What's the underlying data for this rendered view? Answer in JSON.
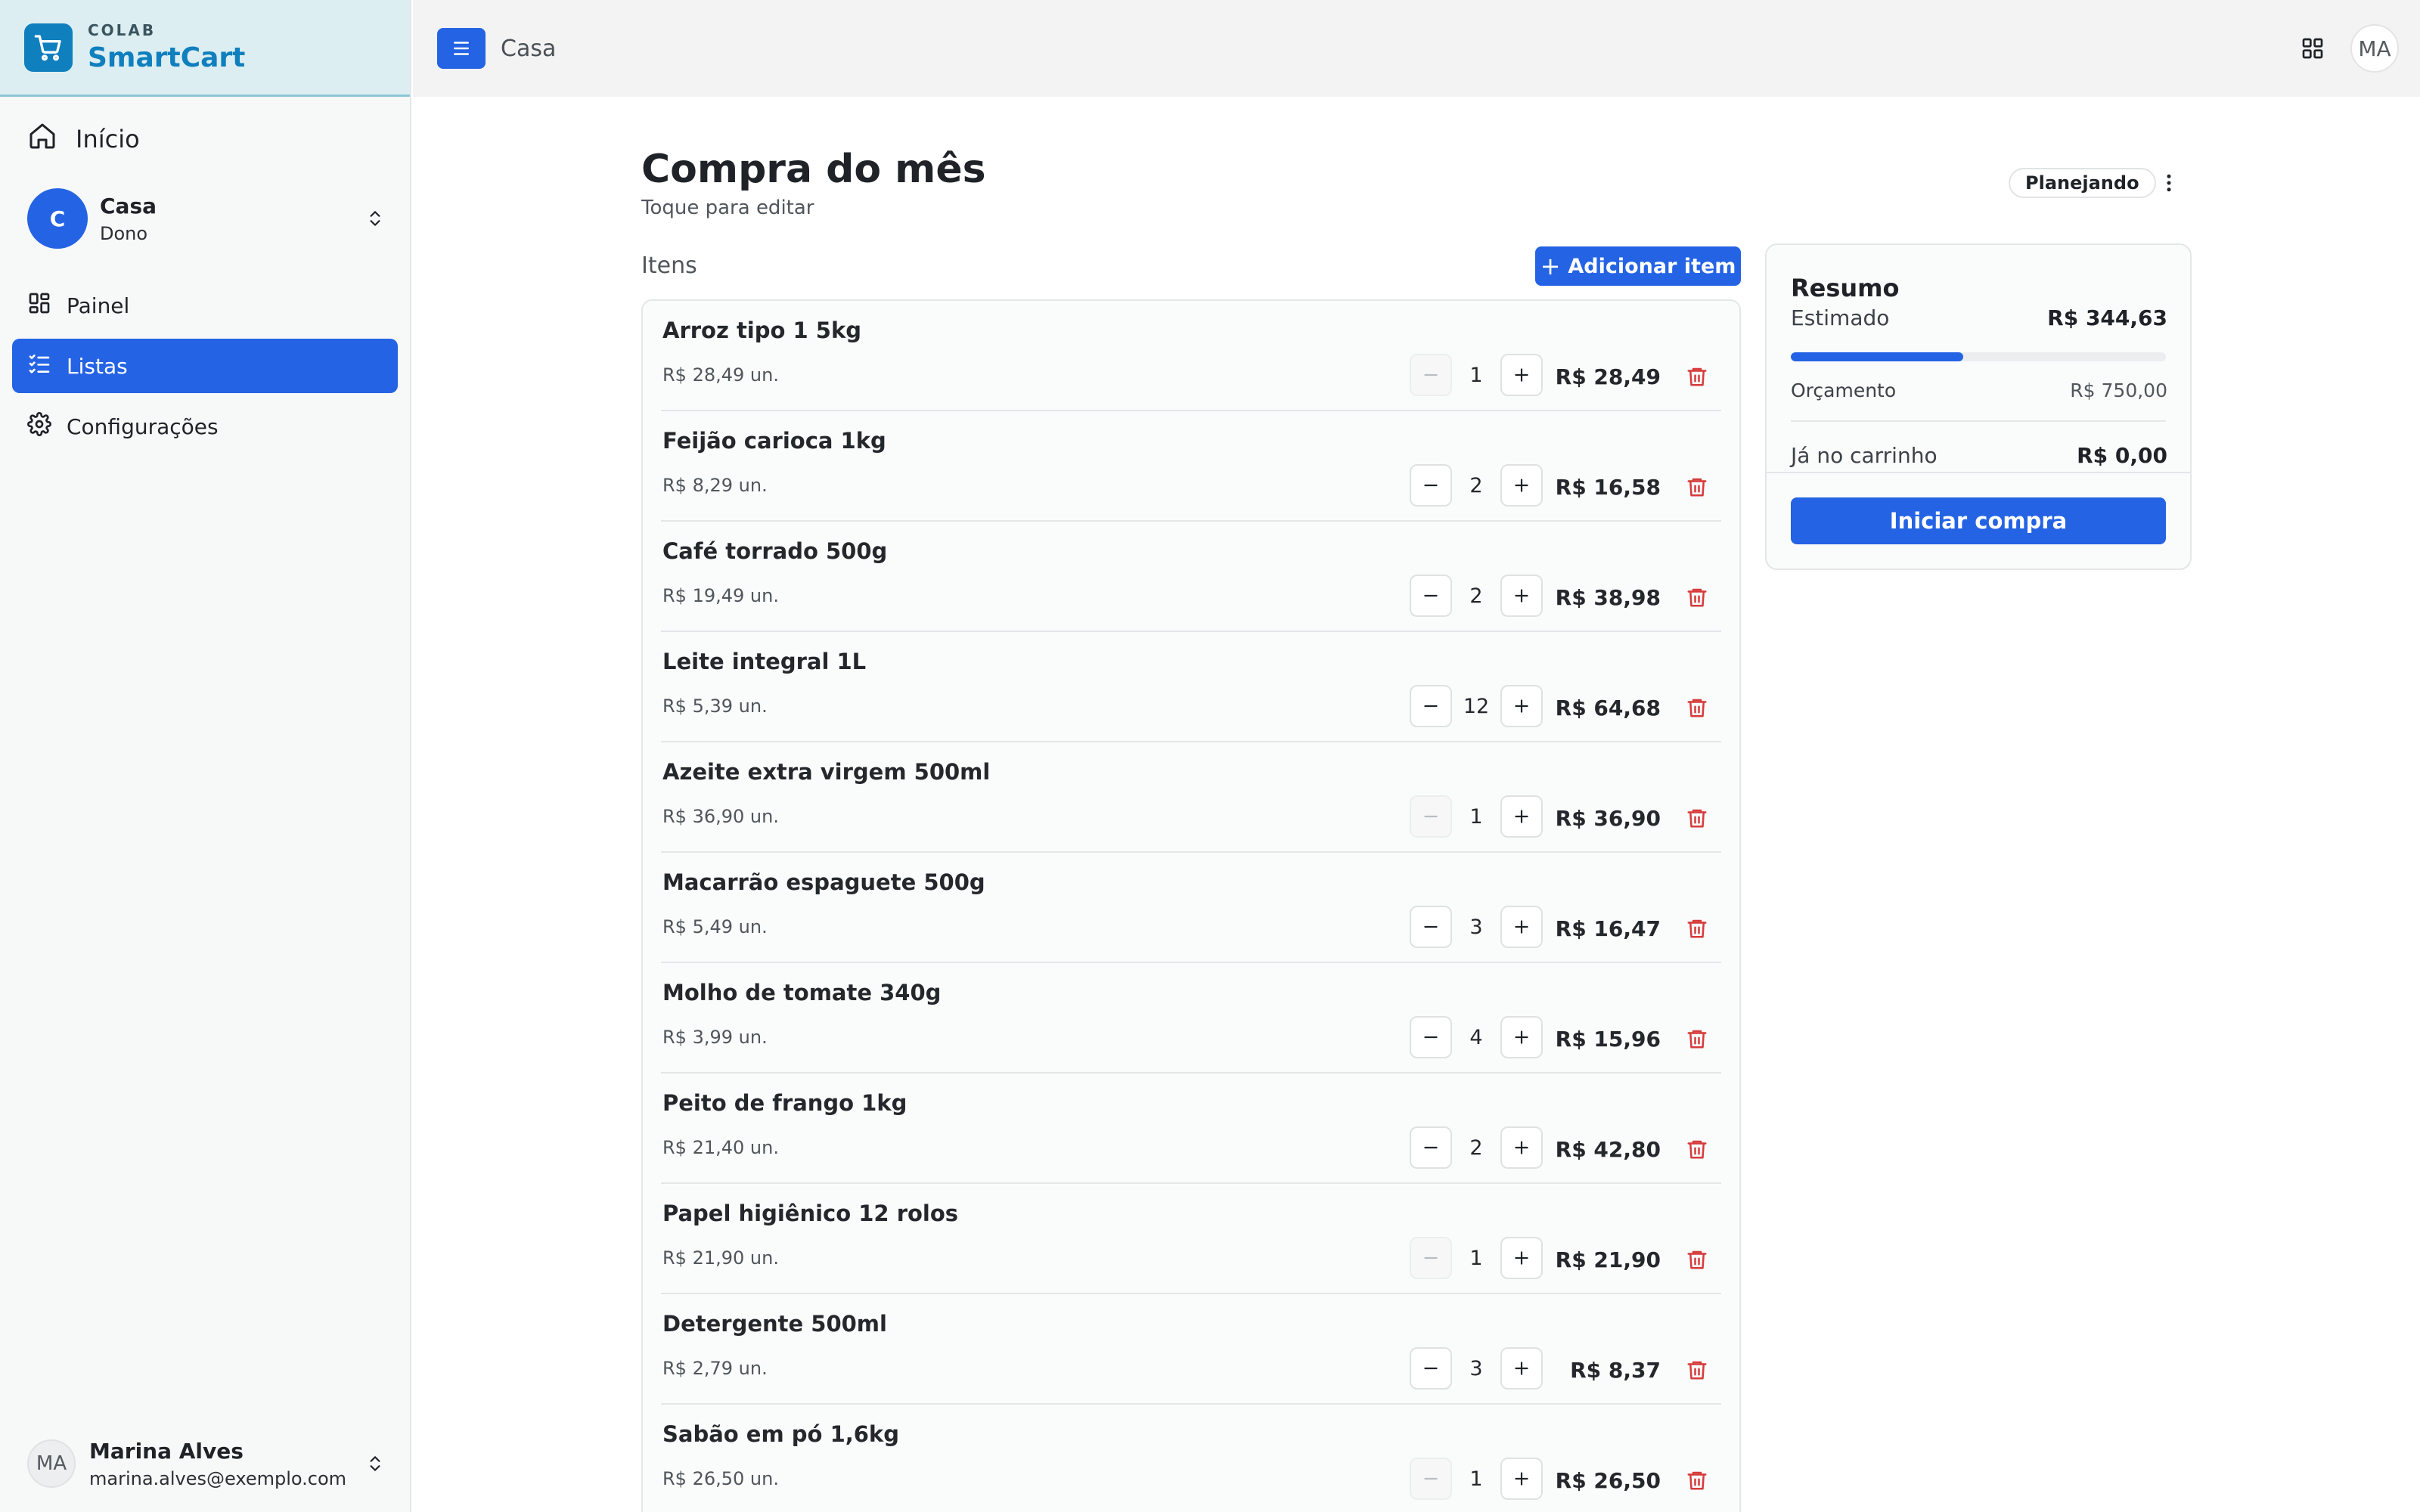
{
  "brand": {
    "small": "COLAB",
    "name": "SmartCart"
  },
  "sidebar": {
    "home_label": "Início",
    "org": {
      "initial": "C",
      "name": "Casa",
      "role": "Dono"
    },
    "items": [
      {
        "label": "Painel",
        "icon": "dashboard-icon",
        "active": false
      },
      {
        "label": "Listas",
        "icon": "list-check-icon",
        "active": true
      },
      {
        "label": "Configurações",
        "icon": "gear-icon",
        "active": false
      }
    ],
    "user": {
      "initials": "MA",
      "name": "Marina Alves",
      "email": "marina.alves@exemplo.com"
    }
  },
  "topbar": {
    "title": "Casa",
    "avatar": "MA"
  },
  "main": {
    "title": "Compra do mês",
    "subtitle": "Toque para editar",
    "status": "Planejando",
    "items_label": "Itens",
    "add_button": "Adicionar item",
    "items": [
      {
        "name": "Arroz tipo 1 5kg",
        "unit": "R$ 28,49 un.",
        "qty": "1",
        "total": "R$ 28,49"
      },
      {
        "name": "Feijão carioca 1kg",
        "unit": "R$ 8,29 un.",
        "qty": "2",
        "total": "R$ 16,58"
      },
      {
        "name": "Café torrado 500g",
        "unit": "R$ 19,49 un.",
        "qty": "2",
        "total": "R$ 38,98"
      },
      {
        "name": "Leite integral 1L",
        "unit": "R$ 5,39 un.",
        "qty": "12",
        "total": "R$ 64,68"
      },
      {
        "name": "Azeite extra virgem 500ml",
        "unit": "R$ 36,90 un.",
        "qty": "1",
        "total": "R$ 36,90"
      },
      {
        "name": "Macarrão espaguete 500g",
        "unit": "R$ 5,49 un.",
        "qty": "3",
        "total": "R$ 16,47"
      },
      {
        "name": "Molho de tomate 340g",
        "unit": "R$ 3,99 un.",
        "qty": "4",
        "total": "R$ 15,96"
      },
      {
        "name": "Peito de frango 1kg",
        "unit": "R$ 21,40 un.",
        "qty": "2",
        "total": "R$ 42,80"
      },
      {
        "name": "Papel higiênico 12 rolos",
        "unit": "R$ 21,90 un.",
        "qty": "1",
        "total": "R$ 21,90"
      },
      {
        "name": "Detergente 500ml",
        "unit": "R$ 2,79 un.",
        "qty": "3",
        "total": "R$ 8,37"
      },
      {
        "name": "Sabão em pó 1,6kg",
        "unit": "R$ 26,50 un.",
        "qty": "1",
        "total": "R$ 26,50"
      }
    ]
  },
  "summary": {
    "title": "Resumo",
    "estimated_label": "Estimado",
    "estimated_value": "R$ 344,63",
    "budget_label": "Orçamento",
    "budget_value": "R$ 750,00",
    "progress_fraction": 0.46,
    "cart_label": "Já no carrinho",
    "cart_value": "R$ 0,00",
    "start_button": "Iniciar compra"
  },
  "colors": {
    "primary": "#2463e4",
    "brand": "#0f7fbe",
    "danger": "#d63b3b"
  }
}
